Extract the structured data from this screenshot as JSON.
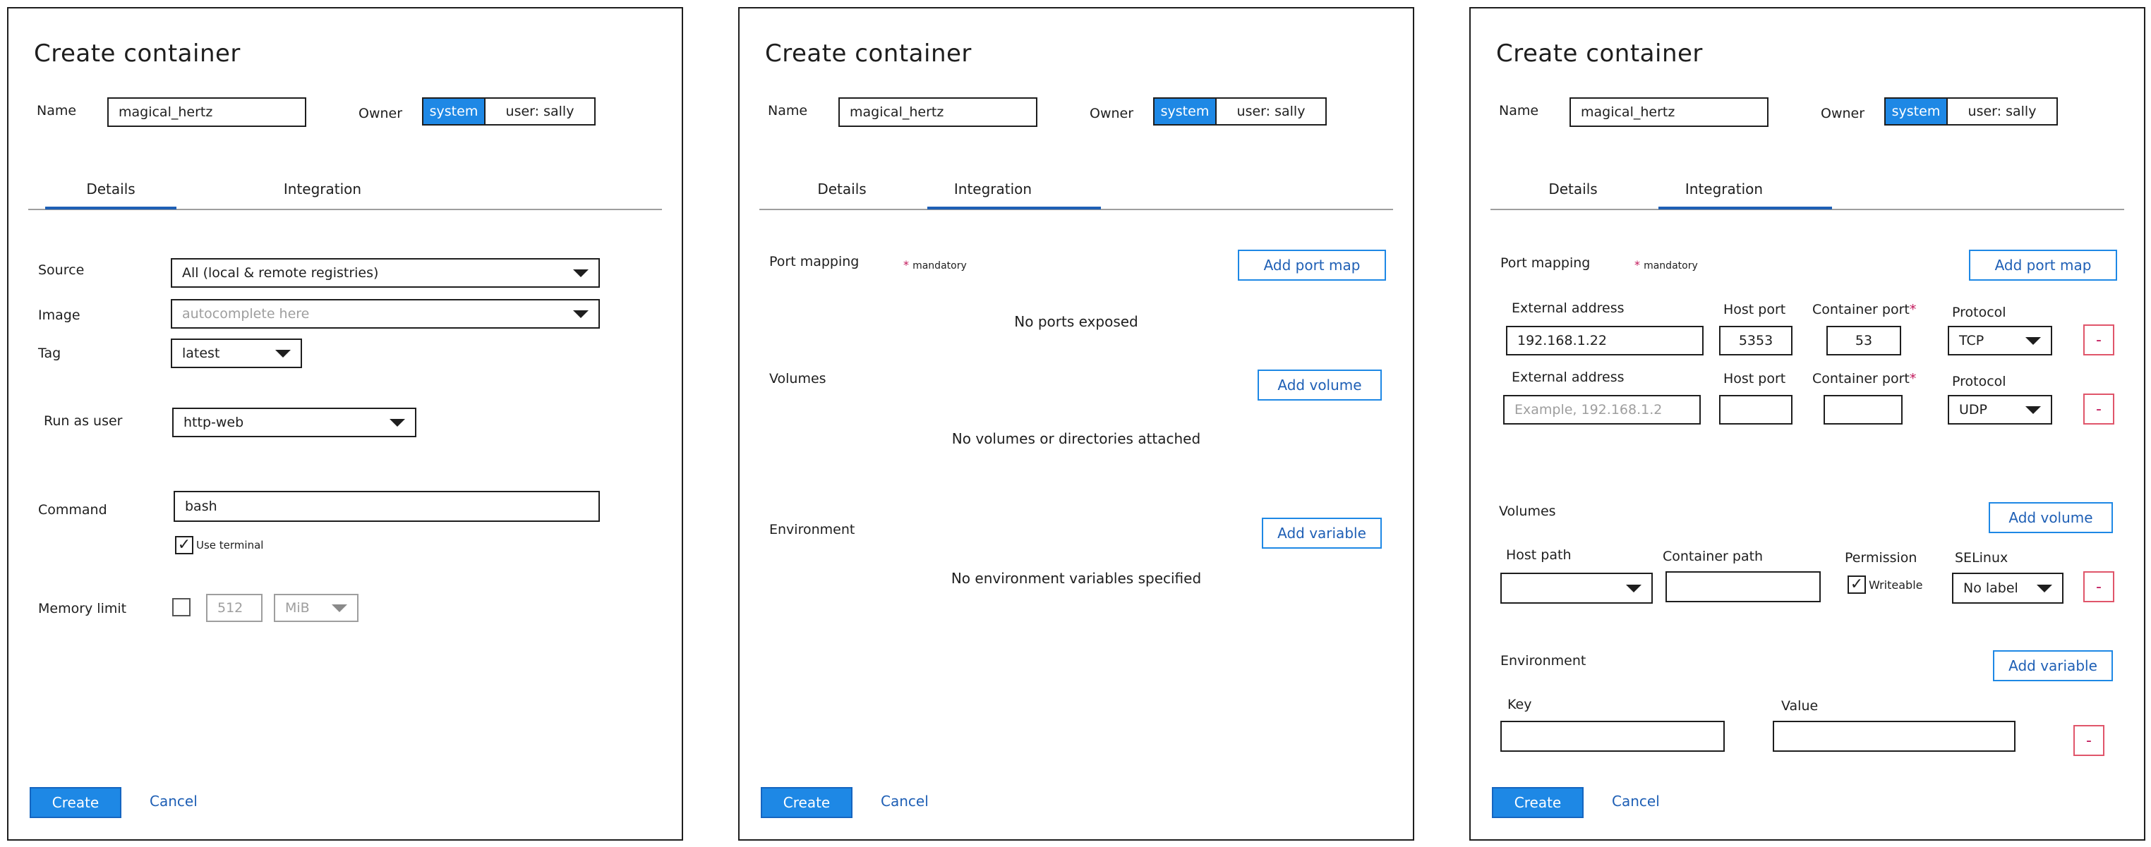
{
  "common": {
    "title": "Create container",
    "name_label": "Name",
    "name_value": "magical_hertz",
    "owner_label": "Owner",
    "owner_system": "system",
    "owner_user": "user: sally",
    "tab_details": "Details",
    "tab_integration": "Integration",
    "create_label": "Create",
    "cancel_label": "Cancel"
  },
  "details": {
    "source_label": "Source",
    "source_value": "All (local & remote registries)",
    "image_label": "Image",
    "image_placeholder": "autocomplete here",
    "tag_label": "Tag",
    "tag_value": "latest",
    "run_as_label": "Run as user",
    "run_as_value": "http-web",
    "command_label": "Command",
    "command_value": "bash",
    "use_terminal_label": "Use terminal",
    "memory_label": "Memory limit",
    "memory_value": "512",
    "memory_unit": "MiB"
  },
  "integration_empty": {
    "port_mapping_label": "Port mapping",
    "mandatory_label": "mandatory",
    "add_port_label": "Add port map",
    "no_ports": "No ports exposed",
    "volumes_label": "Volumes",
    "add_volume_label": "Add volume",
    "no_volumes": "No volumes or directories attached",
    "environment_label": "Environment",
    "add_variable_label": "Add variable",
    "no_env": "No environment variables specified"
  },
  "integration_filled": {
    "port_mapping_label": "Port mapping",
    "mandatory_label": "mandatory",
    "add_port_label": "Add port map",
    "ext_addr_label": "External address",
    "host_port_label": "Host port",
    "container_port_label": "Container port",
    "protocol_label": "Protocol",
    "row1_ext": "192.168.1.22",
    "row1_host": "5353",
    "row1_container": "53",
    "row1_protocol": "TCP",
    "row2_ext_placeholder": "Example, 192.168.1.2",
    "row2_protocol": "UDP",
    "volumes_label": "Volumes",
    "add_volume_label": "Add volume",
    "host_path_label": "Host path",
    "container_path_label": "Container path",
    "permission_label": "Permission",
    "writeable_label": "Writeable",
    "selinux_label": "SELinux",
    "selinux_value": "No label",
    "environment_label": "Environment",
    "add_variable_label": "Add variable",
    "key_label": "Key",
    "value_label": "Value",
    "remove_symbol": "-",
    "asterisk": "*"
  },
  "colors": {
    "accent": "#1e88e5",
    "link": "#1e5fb5",
    "danger": "#e0556a"
  }
}
